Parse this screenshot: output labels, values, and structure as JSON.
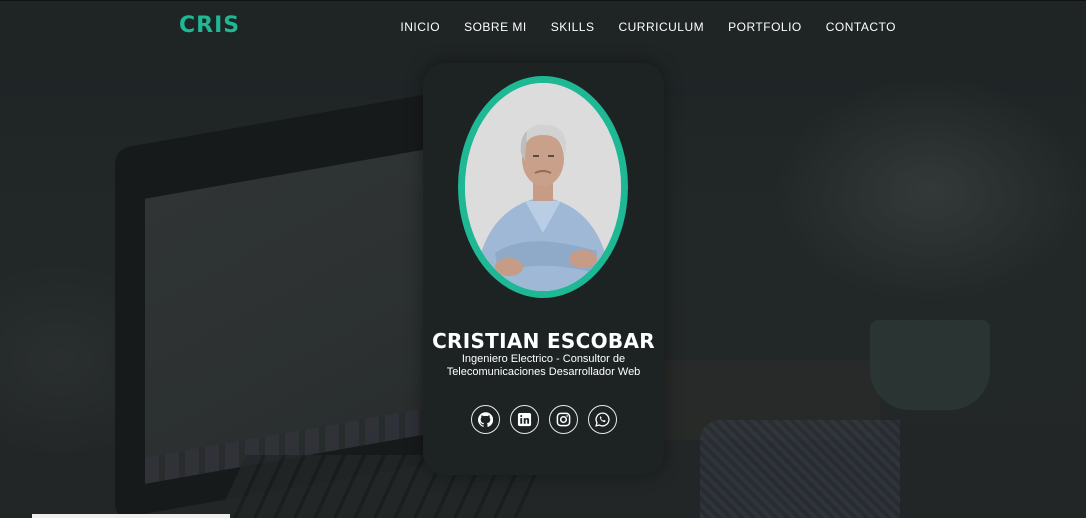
{
  "brand": {
    "logo": "CRIS",
    "accent": "#1fb894"
  },
  "nav": {
    "items": [
      {
        "label": "INICIO"
      },
      {
        "label": "SOBRE MI"
      },
      {
        "label": "SKILLS"
      },
      {
        "label": "CURRICULUM"
      },
      {
        "label": "PORTFOLIO"
      },
      {
        "label": "CONTACTO"
      }
    ]
  },
  "profile": {
    "name": "CRISTIAN ESCOBAR",
    "role": "Ingeniero Electrico - Consultor de Telecomunicaciones Desarrollador Web",
    "photo_icon": "profile-photo"
  },
  "socials": [
    {
      "icon": "github-icon"
    },
    {
      "icon": "linkedin-icon"
    },
    {
      "icon": "instagram-icon"
    },
    {
      "icon": "whatsapp-icon"
    }
  ]
}
